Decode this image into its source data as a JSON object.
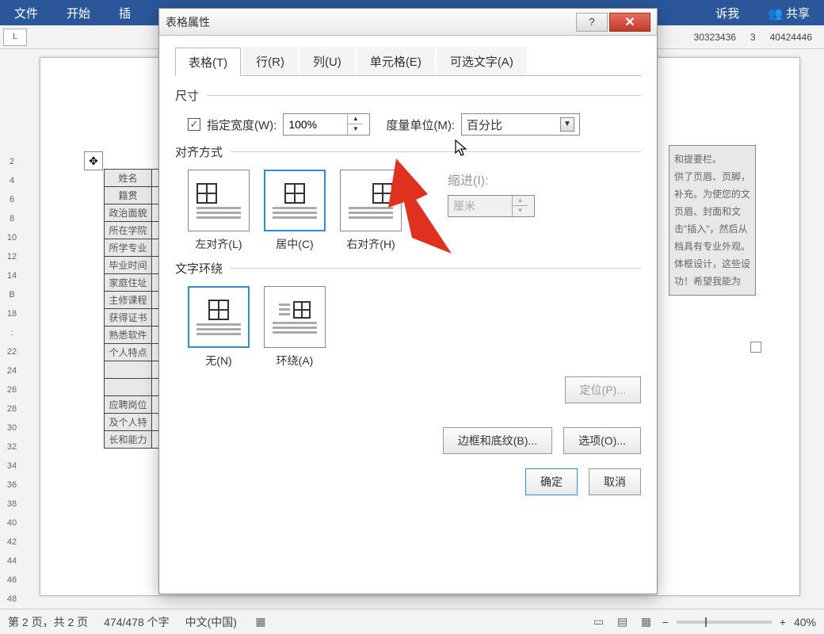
{
  "ribbon": {
    "items": [
      "文件",
      "开始",
      "插"
    ],
    "tellme": "诉我",
    "share": "共享"
  },
  "rulerCorner": "L",
  "rulerRight": [
    "30323436",
    "3",
    "40424446"
  ],
  "vruler": [
    "2",
    "4",
    "6",
    "8",
    "10",
    "12",
    "14",
    "B",
    "18",
    ":",
    "22",
    "24",
    "26",
    "28",
    "30",
    "32",
    "34",
    "36",
    "38",
    "40",
    "42",
    "44",
    "46",
    "48"
  ],
  "moveHandle": "✥",
  "bgTable": {
    "rows": [
      "姓名",
      "籍贯",
      "政治面貌",
      "所在学院",
      "所学专业",
      "毕业时间",
      "家庭住址",
      "主修课程",
      "获得证书",
      "熟悉软件",
      "个人特点",
      "",
      "",
      "应聘岗位",
      "及个人特",
      "长和能力"
    ]
  },
  "rightSnip": {
    "lines": [
      "和提要栏。",
      "供了页眉、页脚，",
      "补充。为使您的文",
      "页眉、封面和文",
      "击\"插入\"，然后从",
      "档具有专业外观。",
      "体框设计，这些设",
      "功！希望我能为"
    ]
  },
  "dialog": {
    "title": "表格属性",
    "help": "?",
    "close": "✕",
    "tabs": {
      "table": "表格(T)",
      "row": "行(R)",
      "column": "列(U)",
      "cell": "单元格(E)",
      "alttext": "可选文字(A)"
    },
    "size": {
      "label": "尺寸",
      "checkLabel": "指定宽度(W):",
      "checked": "✓",
      "widthValue": "100%",
      "unitLabel": "度量单位(M):",
      "unitValue": "百分比"
    },
    "align": {
      "label": "对齐方式",
      "left": "左对齐(L)",
      "center": "居中(C)",
      "right": "右对齐(H)",
      "indentLabel": "缩进(I):",
      "indentUnit": "厘米"
    },
    "wrap": {
      "label": "文字环绕",
      "none": "无(N)",
      "around": "环绕(A)",
      "position": "定位(P)..."
    },
    "buttons": {
      "border": "边框和底纹(B)...",
      "options": "选项(O)...",
      "ok": "确定",
      "cancel": "取消"
    }
  },
  "status": {
    "page": "第 2 页，共 2 页",
    "words": "474/478 个字",
    "lang": "中文(中国)",
    "zoom": "40%",
    "minus": "−",
    "plus": "+"
  }
}
